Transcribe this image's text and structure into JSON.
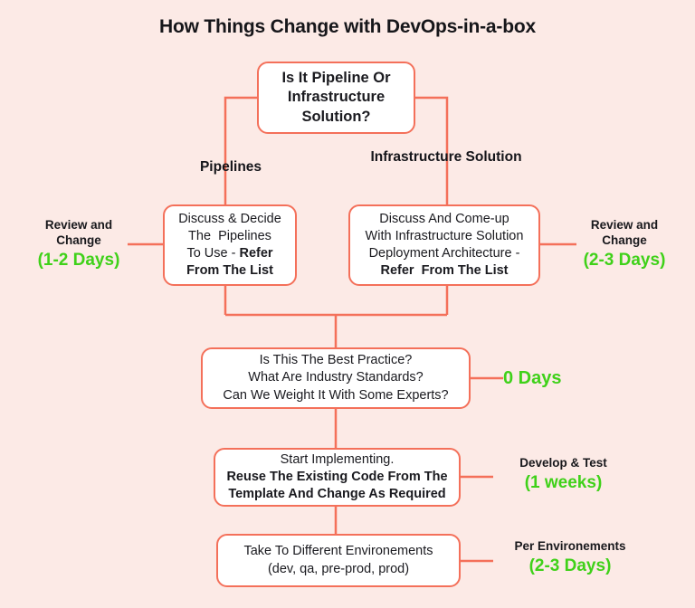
{
  "title": "How Things Change with DevOps-in-a-box",
  "colors": {
    "background": "#fceae6",
    "node_border": "#f4705a",
    "node_fill": "#ffffff",
    "connector": "#f4705a",
    "text": "#1a1a1f",
    "duration": "#3fd119"
  },
  "nodes": {
    "decision": {
      "line1": "Is It Pipeline Or",
      "line2": "Infrastructure",
      "line3": "Solution?"
    },
    "pipelines_box": {
      "line1": "Discuss & Decide",
      "line2": "The  Pipelines",
      "line3": "To Use - ",
      "line3_bold": "Refer",
      "line4_bold": "From The List"
    },
    "infrastructure_box": {
      "line1": "Discuss And Come-up",
      "line2": "With Infrastructure Solution",
      "line3": "Deployment Architecture -",
      "line4_bold": "Refer  From The List"
    },
    "best_practice_box": {
      "line1": "Is This The Best Practice?",
      "line2": "What Are Industry Standards?",
      "line3": "Can We Weight It With Some Experts?"
    },
    "implement_box": {
      "line1": "Start Implementing.",
      "line2_bold": "Reuse The Existing Code From The",
      "line3_bold": "Template And Change As Required"
    },
    "environments_box": {
      "line1": "Take To Different Environements",
      "line2": "(dev, qa, pre-prod, prod)"
    }
  },
  "branches": {
    "left_label": "Pipelines",
    "right_label_line1": "Infrastructure",
    "right_label_line2": "Solution"
  },
  "annotations": {
    "left": {
      "head_line1": "Review and",
      "head_line2": "Change",
      "duration": "(1-2 Days)"
    },
    "right": {
      "head_line1": "Review and",
      "head_line2": "Change",
      "duration": "(2-3 Days)"
    },
    "best_practice": {
      "duration": "0 Days"
    },
    "implement": {
      "head_line1": "Develop & Test",
      "duration": "(1 weeks)"
    },
    "environments": {
      "head_line1": "Per Environements",
      "duration": "(2-3 Days)"
    }
  }
}
